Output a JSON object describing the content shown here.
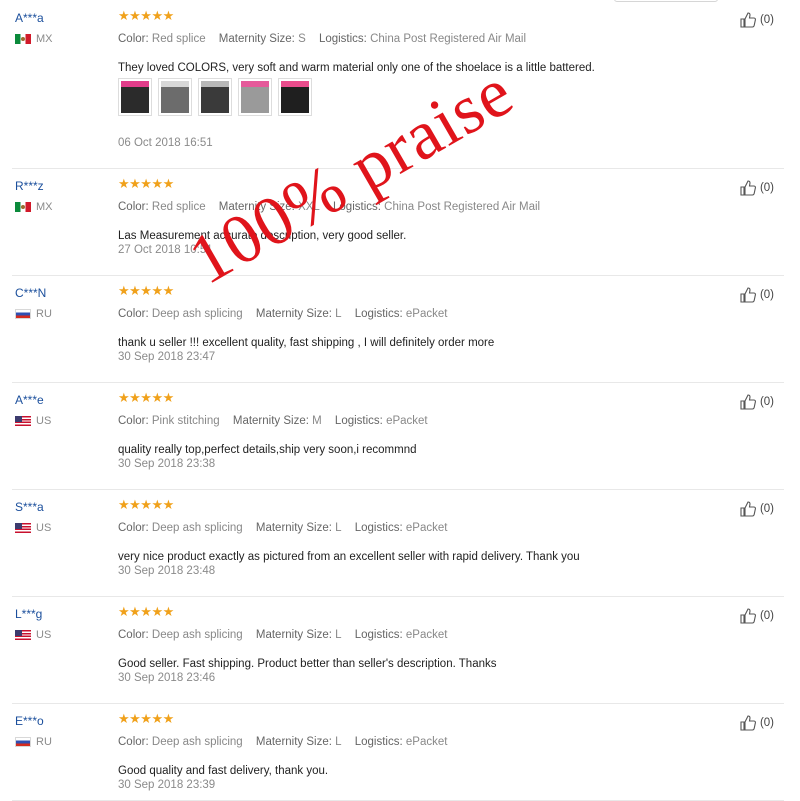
{
  "labels": {
    "color": "Color:",
    "size": "Maternity Size:",
    "logistics": "Logistics:"
  },
  "stars": "★★★★★",
  "watermark": "100% praise",
  "reviews": [
    {
      "user": "A***a",
      "country": "MX",
      "flag": "mx",
      "color": "Red splice",
      "size": "S",
      "logistics": "China Post Registered Air Mail",
      "text": "They loved COLORS, very soft and warm material only one of the shoelace is a little battered.",
      "date": "06 Oct 2018 16:51",
      "likes": "(0)",
      "has_photos": true
    },
    {
      "user": "R***z",
      "country": "MX",
      "flag": "mx",
      "color": "Red splice",
      "size": "XXL",
      "logistics": "China Post Registered Air Mail",
      "text": "Las Measurement accurate description, very good seller.",
      "date": "27 Oct 2018 10:51",
      "likes": "(0)"
    },
    {
      "user": "C***N",
      "country": "RU",
      "flag": "ru",
      "color": "Deep ash splicing",
      "size": "L",
      "logistics": "ePacket",
      "text": "thank u seller !!! excellent quality, fast shipping , I will definitely order more",
      "date": "30 Sep 2018 23:47",
      "likes": "(0)"
    },
    {
      "user": "A***e",
      "country": "US",
      "flag": "us",
      "color": "Pink stitching",
      "size": "M",
      "logistics": "ePacket",
      "text": "quality really top,perfect details,ship very soon,i recommnd",
      "date": "30 Sep 2018 23:38",
      "likes": "(0)"
    },
    {
      "user": "S***a",
      "country": "US",
      "flag": "us",
      "color": "Deep ash splicing",
      "size": "L",
      "logistics": "ePacket",
      "text": "very nice product exactly as pictured from an excellent seller with rapid delivery. Thank you",
      "date": "30 Sep 2018 23:48",
      "likes": "(0)"
    },
    {
      "user": "L***g",
      "country": "US",
      "flag": "us",
      "color": "Deep ash splicing",
      "size": "L",
      "logistics": "ePacket",
      "text": "Good seller. Fast shipping. Product better than seller's description. Thanks",
      "date": "30 Sep 2018 23:46",
      "likes": "(0)"
    },
    {
      "user": "E***o",
      "country": "RU",
      "flag": "ru",
      "color": "Deep ash splicing",
      "size": "L",
      "logistics": "ePacket",
      "text": "Good quality and fast delivery, thank you.",
      "date": "30 Sep 2018 23:39",
      "likes": "(0)"
    }
  ]
}
